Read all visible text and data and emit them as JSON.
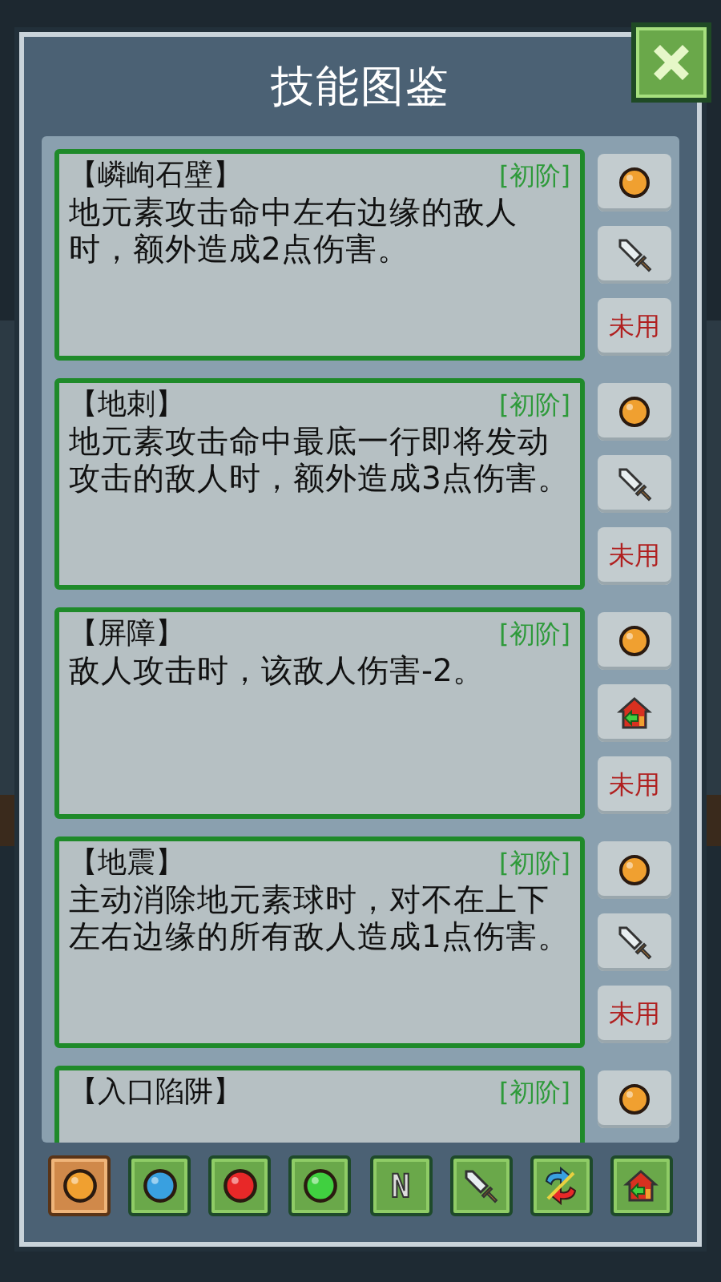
{
  "title": "技能图鉴",
  "skills": [
    {
      "name": "【嶙峋石壁】",
      "tier": "[初阶]",
      "description": "地元素攻击命中左右边缘的敌人时，额外造成2点伤害。",
      "buttons": [
        {
          "kind": "earth"
        },
        {
          "kind": "sword"
        },
        {
          "kind": "status",
          "label": "未用"
        }
      ]
    },
    {
      "name": "【地刺】",
      "tier": "[初阶]",
      "description": "地元素攻击命中最底一行即将发动攻击的敌人时，额外造成3点伤害。",
      "buttons": [
        {
          "kind": "earth"
        },
        {
          "kind": "sword"
        },
        {
          "kind": "status",
          "label": "未用"
        }
      ]
    },
    {
      "name": "【屏障】",
      "tier": "[初阶]",
      "description": "敌人攻击时，该敌人伤害-2。",
      "buttons": [
        {
          "kind": "earth"
        },
        {
          "kind": "house"
        },
        {
          "kind": "status",
          "label": "未用"
        }
      ]
    },
    {
      "name": "【地震】",
      "tier": "[初阶]",
      "description": "主动消除地元素球时，对不在上下左右边缘的所有敌人造成1点伤害。",
      "buttons": [
        {
          "kind": "earth"
        },
        {
          "kind": "sword"
        },
        {
          "kind": "status",
          "label": "未用"
        }
      ]
    },
    {
      "name": "【入口陷阱】",
      "tier": "[初阶]",
      "buttons": [
        {
          "kind": "earth"
        }
      ]
    }
  ],
  "filters": [
    {
      "kind": "earth",
      "selected": true
    },
    {
      "kind": "water",
      "selected": false
    },
    {
      "kind": "fire",
      "selected": false
    },
    {
      "kind": "wood",
      "selected": false
    },
    {
      "kind": "letter",
      "label": "N",
      "selected": false
    },
    {
      "kind": "sword",
      "selected": false
    },
    {
      "kind": "swap",
      "selected": false
    },
    {
      "kind": "house",
      "selected": false
    }
  ]
}
